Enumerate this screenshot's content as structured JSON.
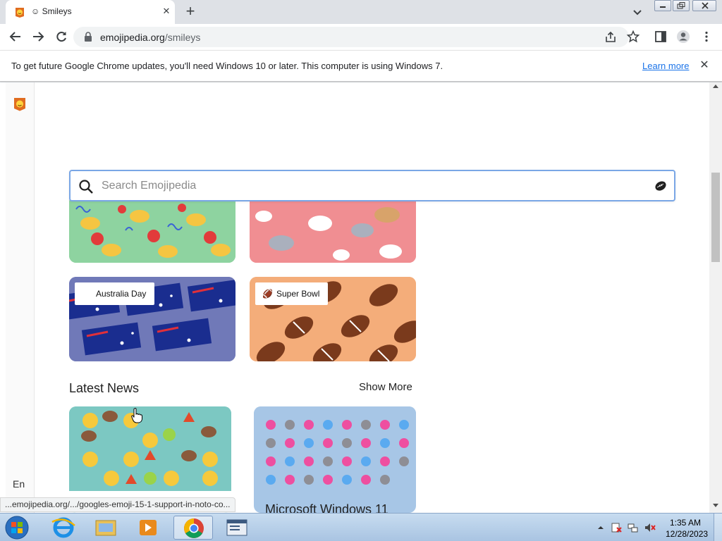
{
  "browser": {
    "tab": {
      "title": "Smileys",
      "title_emoji": "☺"
    },
    "url_host": "emojipedia.org",
    "url_path": "/smileys",
    "infobar": {
      "message": "To get future Google Chrome updates, you'll need Windows 10 or later. This computer is using Windows 7.",
      "link": "Learn more"
    },
    "status_url": "...emojipedia.org/.../googles-emoji-15-1-support-in-noto-co..."
  },
  "page": {
    "search_placeholder": "Search Emojipedia",
    "cards": [
      {
        "label": "Australia Day",
        "glyph": ""
      },
      {
        "label": "Super Bowl",
        "glyph": "🏈"
      }
    ],
    "latest_news": {
      "title": "Latest News",
      "show_more": "Show More",
      "articles": [
        {
          "title": ""
        },
        {
          "title": "Microsoft Windows 11"
        }
      ]
    },
    "language": "En"
  },
  "taskbar": {
    "time": "1:35 AM",
    "date": "12/28/2023"
  },
  "colors": {
    "accent": "#1a73e8",
    "search_border": "#7aa7e6"
  }
}
